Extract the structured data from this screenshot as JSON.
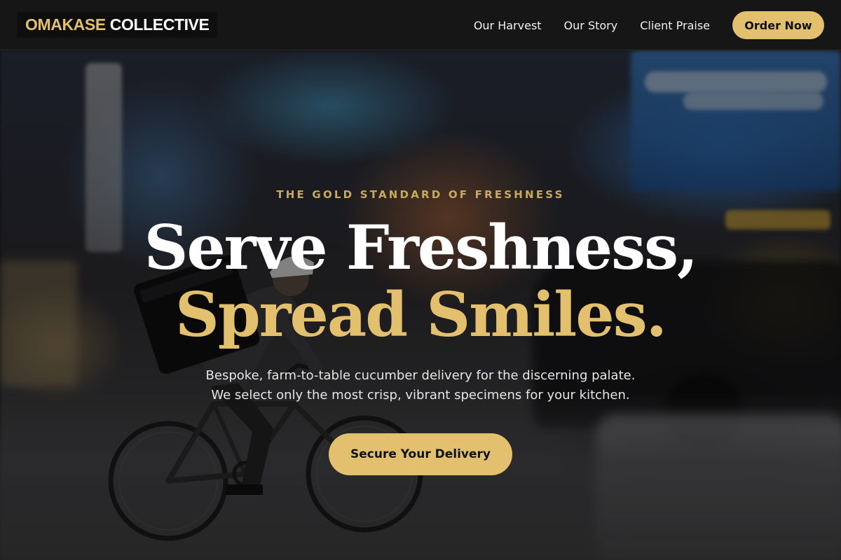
{
  "brand": {
    "name_part1": "OMAKASE",
    "name_part2": "COLLECTIVE"
  },
  "nav": {
    "items": [
      {
        "label": "Our Harvest"
      },
      {
        "label": "Our Story"
      },
      {
        "label": "Client Praise"
      }
    ],
    "cta_label": "Order Now"
  },
  "hero": {
    "eyebrow": "THE GOLD STANDARD OF FRESHNESS",
    "headline_line1": "Serve Freshness,",
    "headline_line2": "Spread Smiles.",
    "subtext_line1": "Bespoke, farm-to-table cucumber delivery for the discerning palate.",
    "subtext_line2": "We select only the most crisp, vibrant specimens for your kitchen.",
    "cta_label": "Secure Your Delivery",
    "background_image": "blurred city street with delivery cyclist"
  },
  "colors": {
    "accent_gold": "#e2c06d",
    "header_bg": "#161616",
    "text_white": "#ffffff"
  }
}
